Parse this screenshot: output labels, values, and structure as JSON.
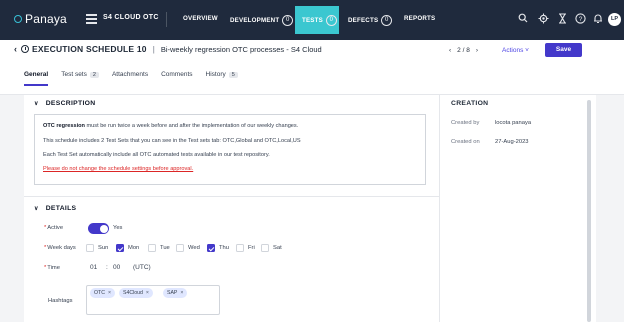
{
  "topnav": {
    "logo": "Panaya",
    "project": "S4 CLOUD OTC",
    "items": [
      {
        "label": "OVERVIEW",
        "count": null
      },
      {
        "label": "DEVELOPMENT",
        "count": "0"
      },
      {
        "label": "TESTS",
        "count": "0"
      },
      {
        "label": "DEFECTS",
        "count": "0"
      },
      {
        "label": "REPORTS",
        "count": null
      }
    ],
    "avatar": "LP",
    "icons": [
      "search-icon",
      "settings-icon",
      "hourglass-icon",
      "help-icon",
      "bell-icon"
    ]
  },
  "header": {
    "title": "EXECUTION SCHEDULE 10",
    "separator": "|",
    "subtitle": "Bi-weekly regression OTC processes - S4 Cloud",
    "pager": "2 / 8",
    "actions_label": "Actions",
    "save_label": "Save"
  },
  "tabs": [
    {
      "label": "General",
      "badge": null
    },
    {
      "label": "Test sets",
      "badge": "2"
    },
    {
      "label": "Attachments",
      "badge": null
    },
    {
      "label": "Comments",
      "badge": null
    },
    {
      "label": "History",
      "badge": "5"
    }
  ],
  "description": {
    "section_title": "DESCRIPTION",
    "line1_bold": "OTC regression",
    "line1_rest": " must be run twice a week before and after the implementation of our weekly changes.",
    "line2": "This schedule includes 2 Test Sets that you can see in the Test sets tab: OTC,Global and OTC,Local,US",
    "line3": "Each Test Set automatically include all OTC automated tests available in our test repository.",
    "line4": "Please do not change the schedule settings before approval."
  },
  "creation": {
    "section_title": "CREATION",
    "created_by_label": "Created by",
    "created_by": "locota panaya",
    "created_on_label": "Created on",
    "created_on": "27-Aug-2023"
  },
  "details": {
    "section_title": "DETAILS",
    "active_label": "Active",
    "active_value": "Yes",
    "active": true,
    "weekdays_label": "Week days",
    "days": [
      {
        "label": "Sun",
        "checked": false
      },
      {
        "label": "Mon",
        "checked": true
      },
      {
        "label": "Tue",
        "checked": false
      },
      {
        "label": "Wed",
        "checked": false
      },
      {
        "label": "Thu",
        "checked": true
      },
      {
        "label": "Fri",
        "checked": false
      },
      {
        "label": "Sat",
        "checked": false
      }
    ],
    "time_label": "Time",
    "time_hh": "01",
    "time_colon": ":",
    "time_mm": "00",
    "time_tz": "(UTC)",
    "hashtags_label": "Hashtags",
    "hashtags": [
      "OTC",
      "S4Cloud",
      "SAP"
    ]
  },
  "colors": {
    "nav_bg": "#1f2a3d",
    "accent": "#4338ca",
    "tests_active": "#3bc7d0",
    "warning": "#dc2626"
  }
}
